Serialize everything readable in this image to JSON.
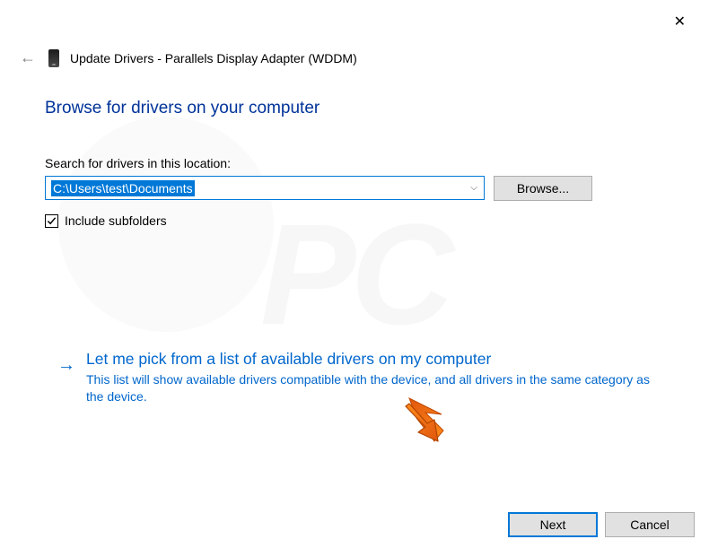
{
  "window": {
    "title": "Update Drivers - Parallels Display Adapter (WDDM)"
  },
  "heading": "Browse for drivers on your computer",
  "search": {
    "label": "Search for drivers in this location:",
    "path": "C:\\Users\\test\\Documents",
    "browse_label": "Browse..."
  },
  "checkbox": {
    "label": "Include subfolders",
    "checked": true
  },
  "pick_option": {
    "title": "Let me pick from a list of available drivers on my computer",
    "description": "This list will show available drivers compatible with the device, and all drivers in the same category as the device."
  },
  "footer": {
    "next": "Next",
    "cancel": "Cancel"
  }
}
